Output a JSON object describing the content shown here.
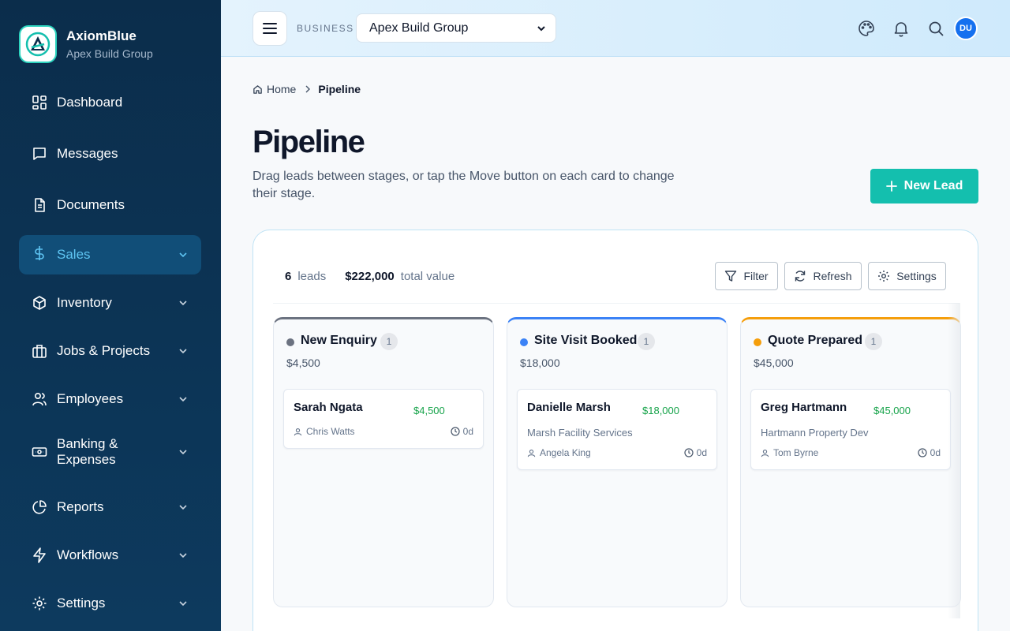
{
  "brand": {
    "name": "AxiomBlue",
    "business": "Apex Build Group"
  },
  "sidebar": {
    "items": [
      {
        "label": "Dashboard",
        "icon": "dashboard-icon",
        "has_chevron": false,
        "active": false
      },
      {
        "label": "Messages",
        "icon": "message-icon",
        "has_chevron": false,
        "active": false
      },
      {
        "label": "Documents",
        "icon": "document-icon",
        "has_chevron": false,
        "active": false
      },
      {
        "label": "Sales",
        "icon": "dollar-icon",
        "has_chevron": true,
        "active": true
      },
      {
        "label": "Inventory",
        "icon": "box-icon",
        "has_chevron": true,
        "active": false
      },
      {
        "label": "Jobs & Projects",
        "icon": "briefcase-icon",
        "has_chevron": true,
        "active": false
      },
      {
        "label": "Employees",
        "icon": "users-icon",
        "has_chevron": true,
        "active": false
      },
      {
        "label": "Banking & Expenses",
        "icon": "banknote-icon",
        "has_chevron": true,
        "active": false
      },
      {
        "label": "Reports",
        "icon": "pie-chart-icon",
        "has_chevron": true,
        "active": false
      },
      {
        "label": "Workflows",
        "icon": "lightning-icon",
        "has_chevron": true,
        "active": false
      },
      {
        "label": "Settings",
        "icon": "gear-icon",
        "has_chevron": true,
        "active": false
      }
    ]
  },
  "topbar": {
    "business_label": "BUSINESS",
    "business_selected": "Apex Build Group",
    "icons": [
      "palette-icon",
      "bell-icon",
      "search-icon"
    ],
    "avatar_initials": "DU"
  },
  "breadcrumb": {
    "home": "Home",
    "current": "Pipeline"
  },
  "page": {
    "title": "Pipeline",
    "description": "Drag leads between stages, or tap the Move button on each card to change their stage.",
    "new_lead_label": "New Lead"
  },
  "board": {
    "leads_count": "6",
    "leads_label": "leads",
    "total_value": "$222,000",
    "total_label": "total value",
    "filter_label": "Filter",
    "refresh_label": "Refresh",
    "settings_label": "Settings",
    "columns": [
      {
        "title": "New Enquiry",
        "count": "1",
        "total": "$4,500",
        "color": "#6b7280",
        "leads": [
          {
            "name": "Sarah Ngata",
            "amount": "$4,500",
            "company": "",
            "owner": "Chris Watts",
            "age": "0d"
          }
        ]
      },
      {
        "title": "Site Visit Booked",
        "count": "1",
        "total": "$18,000",
        "color": "#3b82f6",
        "leads": [
          {
            "name": "Danielle Marsh",
            "amount": "$18,000",
            "company": "Marsh Facility Services",
            "owner": "Angela King",
            "age": "0d"
          }
        ]
      },
      {
        "title": "Quote Prepared",
        "count": "1",
        "total": "$45,000",
        "color": "#f59e0b",
        "leads": [
          {
            "name": "Greg Hartmann",
            "amount": "$45,000",
            "company": "Hartmann Property Dev",
            "owner": "Tom Byrne",
            "age": "0d"
          }
        ]
      }
    ]
  },
  "colors": {
    "accent": "#14bfae",
    "sidebar_bg": "#0b2d4b",
    "active_text": "#5ec4f2",
    "amount": "#16a34a"
  }
}
